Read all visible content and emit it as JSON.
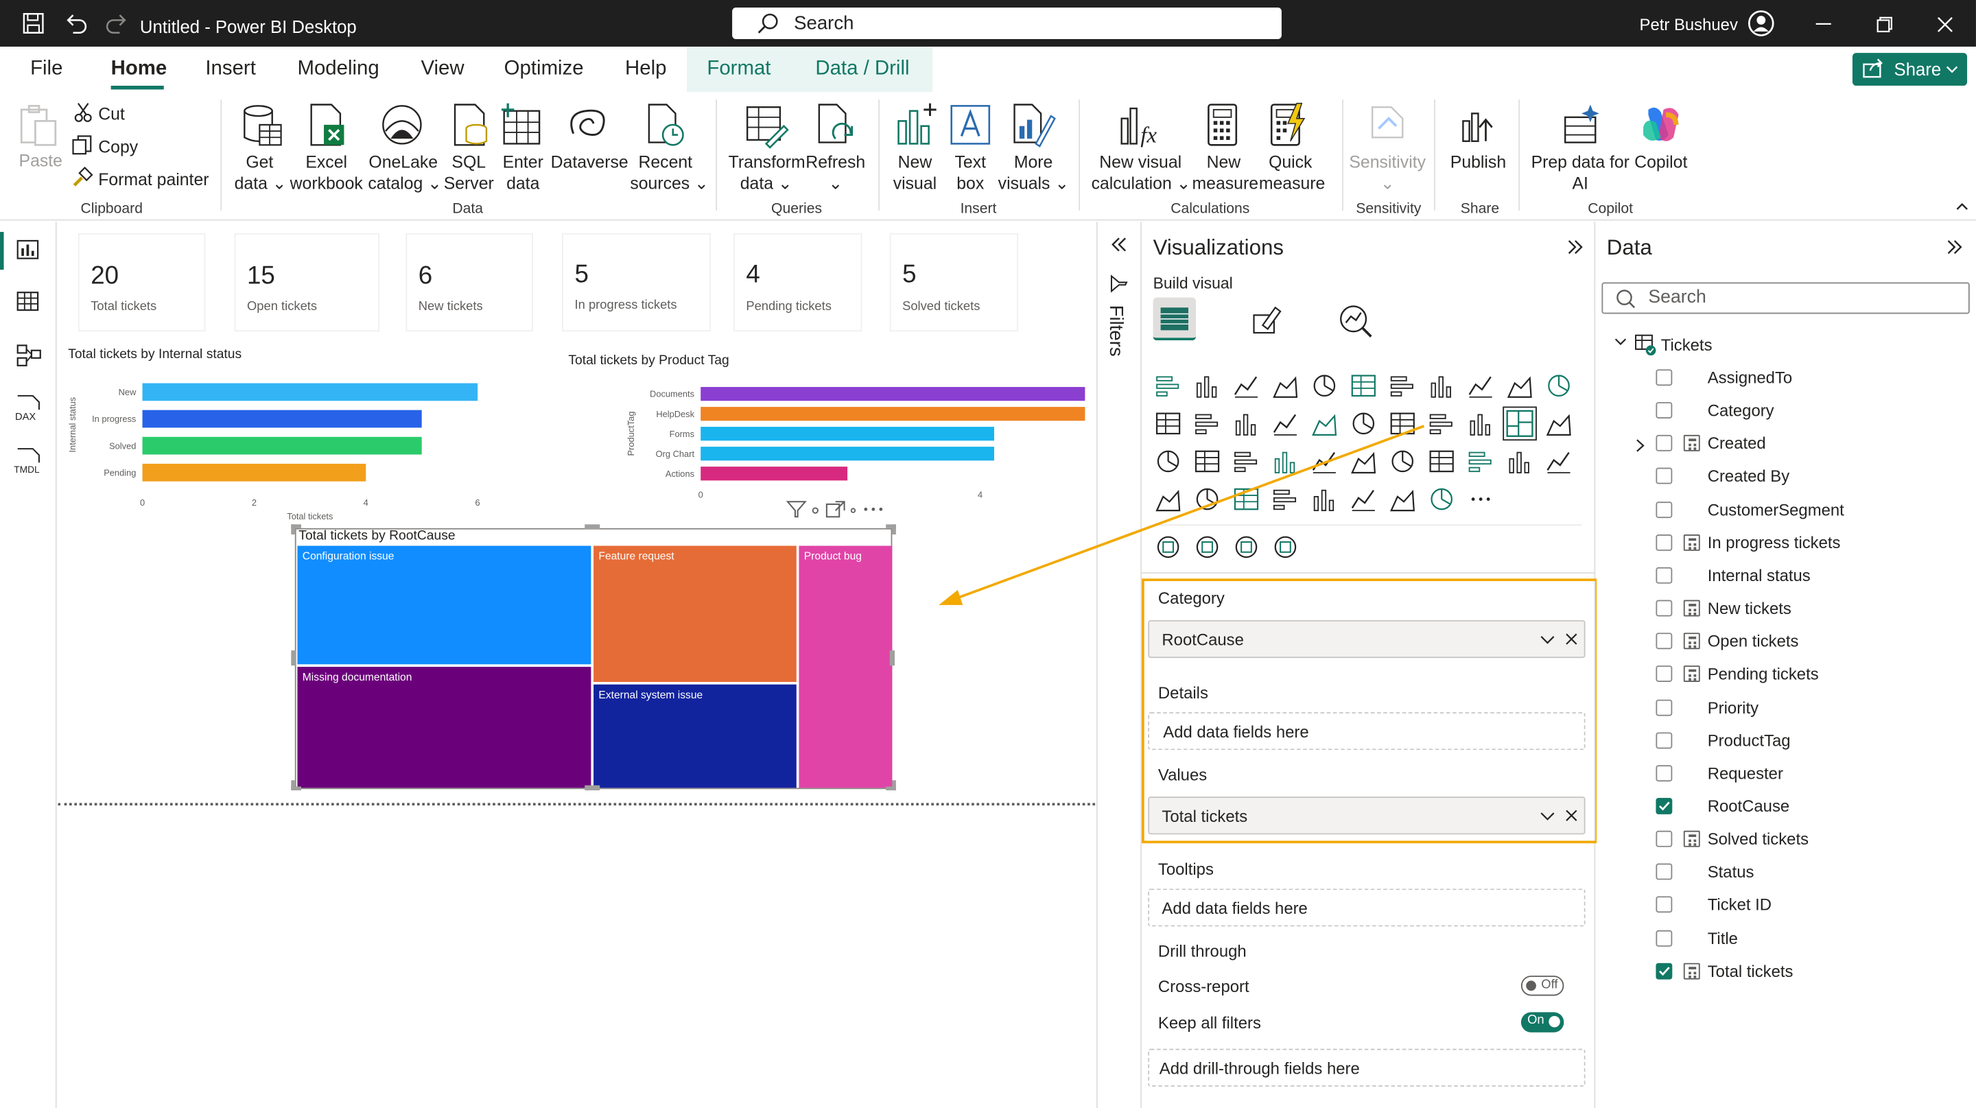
{
  "titlebar": {
    "title": "Untitled - Power BI Desktop",
    "search_placeholder": "Search",
    "user": "Petr Bushuev"
  },
  "menu": {
    "tabs": [
      "File",
      "Home",
      "Insert",
      "Modeling",
      "View",
      "Optimize",
      "Help",
      "Format",
      "Data / Drill"
    ],
    "active": "Home",
    "share": "Share"
  },
  "ribbon": {
    "clipboard": {
      "paste": "Paste",
      "cut": "Cut",
      "copy": "Copy",
      "format_painter": "Format painter",
      "group": "Clipboard"
    },
    "data": {
      "get_data": [
        "Get",
        "data ⌄"
      ],
      "excel": [
        "Excel",
        "workbook"
      ],
      "onelake": [
        "OneLake",
        "catalog ⌄"
      ],
      "sql": [
        "SQL",
        "Server"
      ],
      "enter": [
        "Enter",
        "data"
      ],
      "dataverse": "Dataverse",
      "recent": [
        "Recent",
        "sources ⌄"
      ],
      "group": "Data"
    },
    "queries": {
      "transform": [
        "Transform",
        "data ⌄"
      ],
      "refresh": [
        "Refresh",
        "⌄"
      ],
      "group": "Queries"
    },
    "insert": {
      "new_visual": [
        "New",
        "visual"
      ],
      "text_box": [
        "Text",
        "box"
      ],
      "more_visuals": [
        "More",
        "visuals ⌄"
      ],
      "group": "Insert"
    },
    "calculations": {
      "new_visual_calc": [
        "New visual",
        "calculation ⌄"
      ],
      "new_measure": [
        "New",
        "measure"
      ],
      "quick_measure": [
        "Quick",
        "measure"
      ],
      "group": "Calculations"
    },
    "sensitivity": {
      "label": "Sensitivity",
      "arrow": "⌄",
      "group": "Sensitivity"
    },
    "share": {
      "publish": "Publish",
      "group": "Share"
    },
    "copilot": {
      "prep": [
        "Prep data for",
        "AI"
      ],
      "copilot": "Copilot",
      "group": "Copilot"
    }
  },
  "cards": [
    {
      "value": "20",
      "label": "Total tickets"
    },
    {
      "value": "15",
      "label": "Open tickets"
    },
    {
      "value": "6",
      "label": "New tickets"
    },
    {
      "value": "5",
      "label": "In progress tickets"
    },
    {
      "value": "4",
      "label": "Pending tickets"
    },
    {
      "value": "5",
      "label": "Solved tickets"
    }
  ],
  "chart_data": [
    {
      "type": "bar",
      "orientation": "horizontal",
      "title": "Total tickets by Internal status",
      "ylabel": "Internal status",
      "xlabel": "Total tickets",
      "categories": [
        "New",
        "In progress",
        "Solved",
        "Pending"
      ],
      "values": [
        6,
        5,
        5,
        4
      ],
      "colors": [
        "#34b4f4",
        "#2862e8",
        "#2bcb6b",
        "#f29f1c"
      ],
      "xlim": [
        0,
        6
      ],
      "xticks": [
        "0",
        "2",
        "4",
        "6"
      ]
    },
    {
      "type": "bar",
      "orientation": "horizontal",
      "title": "Total tickets by Product Tag",
      "ylabel": "ProductTag",
      "categories": [
        "Documents",
        "HelpDesk",
        "Forms",
        "Org Chart",
        "Actions"
      ],
      "values": [
        5.5,
        5.5,
        4.2,
        4.2,
        2.1
      ],
      "colors": [
        "#8b3fd1",
        "#f08322",
        "#1ab4ee",
        "#1ab4ee",
        "#d72a7f"
      ],
      "xlim": [
        0,
        5.5
      ],
      "xticks": [
        "0",
        "4"
      ]
    },
    {
      "type": "treemap",
      "title": "Total tickets by RootCause",
      "categories": [
        "Configuration issue",
        "Missing documentation",
        "Feature request",
        "External system issue",
        "Product bug"
      ],
      "colors": [
        "#118dff",
        "#6b007b",
        "#e66c37",
        "#12239e",
        "#e044a7"
      ]
    }
  ],
  "filters": {
    "label": "Filters"
  },
  "viz": {
    "title": "Visualizations",
    "build_visual": "Build visual",
    "category_label": "Category",
    "category_value": "RootCause",
    "details_label": "Details",
    "details_placeholder": "Add data fields here",
    "values_label": "Values",
    "values_value": "Total tickets",
    "tooltips_label": "Tooltips",
    "tooltips_placeholder": "Add data fields here",
    "drill_label": "Drill through",
    "cross_report": "Cross-report",
    "cross_state": "Off",
    "keep_filters": "Keep all filters",
    "keep_state": "On",
    "drill_placeholder": "Add drill-through fields here",
    "highlight_color": "#f2a900"
  },
  "data": {
    "title": "Data",
    "search_placeholder": "Search",
    "table": "Tickets",
    "fields": [
      {
        "name": "AssignedTo",
        "calc": false,
        "checked": false
      },
      {
        "name": "Category",
        "calc": false,
        "checked": false
      },
      {
        "name": "Created",
        "calc": true,
        "checked": false
      },
      {
        "name": "Created By",
        "calc": false,
        "checked": false
      },
      {
        "name": "CustomerSegment",
        "calc": false,
        "checked": false
      },
      {
        "name": "In progress tickets",
        "calc": true,
        "checked": false
      },
      {
        "name": "Internal status",
        "calc": false,
        "checked": false
      },
      {
        "name": "New tickets",
        "calc": true,
        "checked": false
      },
      {
        "name": "Open tickets",
        "calc": true,
        "checked": false
      },
      {
        "name": "Pending tickets",
        "calc": true,
        "checked": false
      },
      {
        "name": "Priority",
        "calc": false,
        "checked": false
      },
      {
        "name": "ProductTag",
        "calc": false,
        "checked": false
      },
      {
        "name": "Requester",
        "calc": false,
        "checked": false
      },
      {
        "name": "RootCause",
        "calc": false,
        "checked": true
      },
      {
        "name": "Solved tickets",
        "calc": true,
        "checked": false
      },
      {
        "name": "Status",
        "calc": false,
        "checked": false
      },
      {
        "name": "Ticket ID",
        "calc": false,
        "checked": false
      },
      {
        "name": "Title",
        "calc": false,
        "checked": false
      },
      {
        "name": "Total tickets",
        "calc": true,
        "checked": true
      }
    ]
  },
  "leftnav": {
    "dax": "DAX",
    "tmdl": "TMDL"
  }
}
